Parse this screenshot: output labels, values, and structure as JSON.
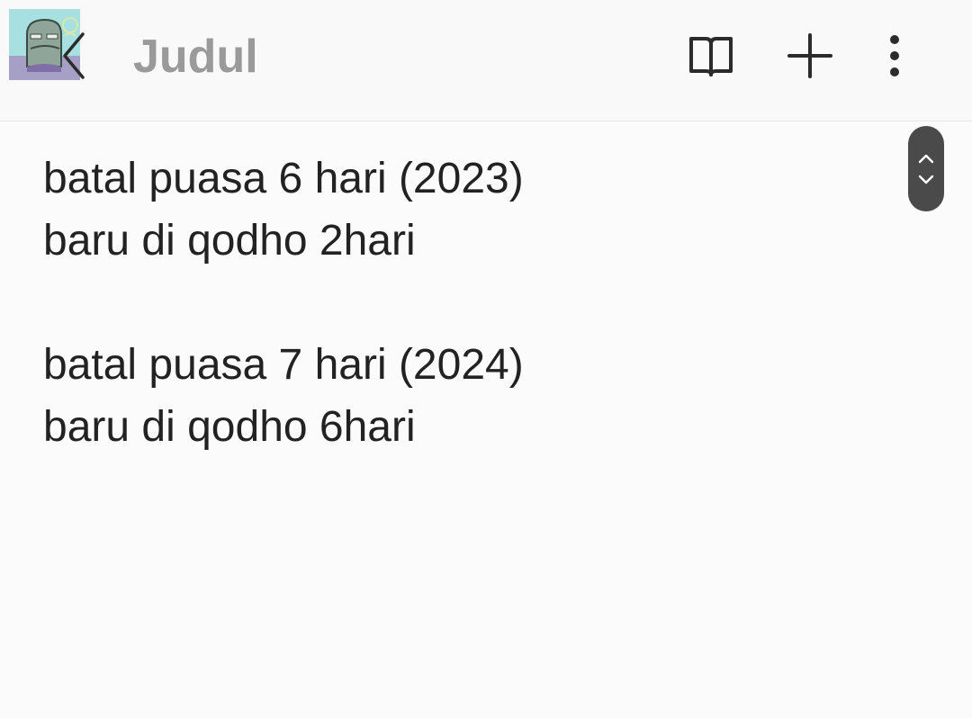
{
  "header": {
    "title": "Judul",
    "avatar_icon": "cartoon-fish-avatar-icon",
    "back_icon": "chevron-left-icon",
    "actions": [
      {
        "name": "reading-mode",
        "icon": "open-book-icon"
      },
      {
        "name": "add",
        "icon": "plus-icon"
      },
      {
        "name": "more-options",
        "icon": "vertical-dots-icon"
      }
    ]
  },
  "note": {
    "paragraphs": [
      {
        "lines": [
          "batal puasa 6 hari (2023)",
          "baru di qodho 2hari"
        ]
      },
      {
        "lines": [
          "batal puasa 7 hari (2024)",
          "baru di qodho 6hari"
        ]
      }
    ]
  },
  "scroll_handle": {
    "up_icon": "chevron-up-icon",
    "down_icon": "chevron-down-icon"
  },
  "colors": {
    "background": "#fbfbfb",
    "title": "#9a9a9a",
    "text": "#222222",
    "icon": "#2b2b2b",
    "scroll_handle": "#4a4a4a"
  }
}
